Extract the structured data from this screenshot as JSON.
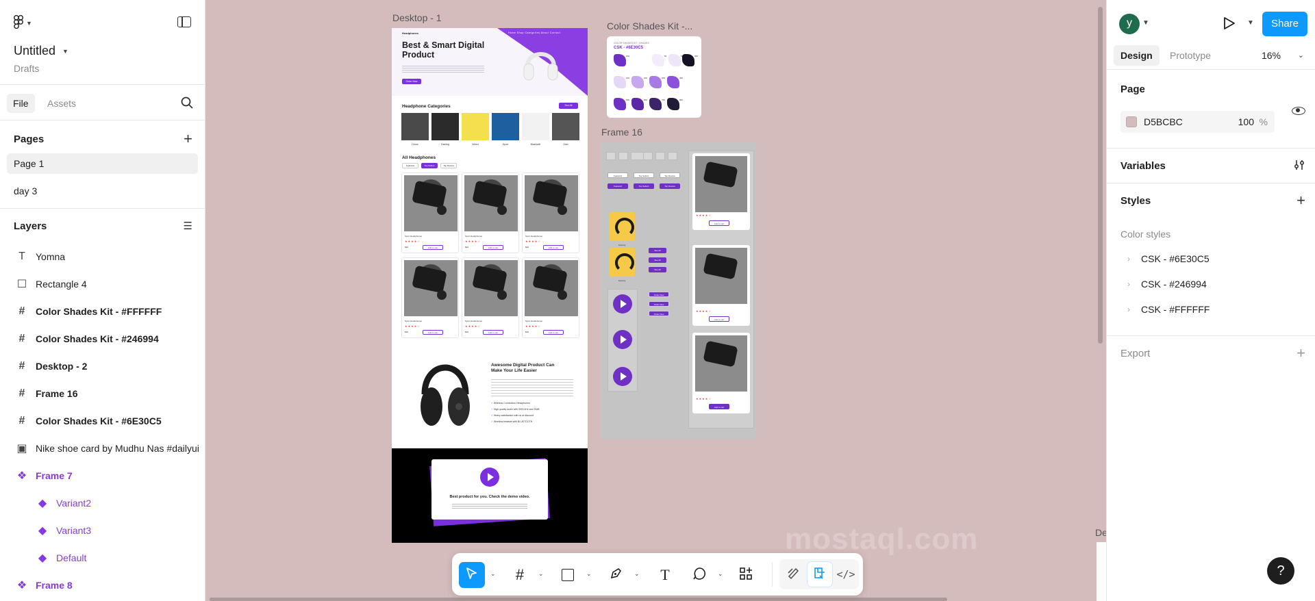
{
  "file": {
    "title": "Untitled",
    "location": "Drafts"
  },
  "left_tabs": {
    "file": "File",
    "assets": "Assets"
  },
  "pages": {
    "heading": "Pages",
    "items": [
      {
        "label": "Page 1",
        "active": true
      },
      {
        "label": "day 3",
        "active": false
      }
    ]
  },
  "layers": {
    "heading": "Layers",
    "items": [
      {
        "label": "Yomna",
        "icon": "text-icon"
      },
      {
        "label": "Rectangle 4",
        "icon": "rectangle-icon"
      },
      {
        "label": "Color Shades Kit - #FFFFFF",
        "icon": "frame-icon"
      },
      {
        "label": "Color Shades Kit - #246994",
        "icon": "frame-icon"
      },
      {
        "label": "Desktop - 2",
        "icon": "frame-icon"
      },
      {
        "label": "Frame 16",
        "icon": "frame-icon"
      },
      {
        "label": "Color Shades Kit - #6E30C5",
        "icon": "frame-icon"
      },
      {
        "label": "Nike shoe card by Mudhu Nas #dailyui",
        "icon": "image-icon"
      },
      {
        "label": "Frame 7",
        "icon": "component-set-icon"
      },
      {
        "label": "Variant2",
        "icon": "component-icon"
      },
      {
        "label": "Variant3",
        "icon": "component-icon"
      },
      {
        "label": "Default",
        "icon": "component-icon"
      },
      {
        "label": "Frame 8",
        "icon": "component-set-icon"
      }
    ]
  },
  "user": {
    "initial": "y",
    "avatar_color": "#1e6b4e"
  },
  "header": {
    "share_label": "Share",
    "share_color": "#0d99ff"
  },
  "right_tabs": {
    "design": "Design",
    "prototype": "Prototype",
    "zoom": "16%"
  },
  "page_section": {
    "title": "Page",
    "background_hex": "D5BCBC",
    "background_color": "#d5bcbc",
    "opacity": "100",
    "opacity_unit": "%"
  },
  "variables": {
    "title": "Variables"
  },
  "styles": {
    "title": "Styles",
    "subheading": "Color styles",
    "items": [
      "CSK - #6E30C5",
      "CSK - #246994",
      "CSK - #FFFFFF"
    ]
  },
  "export": {
    "title": "Export"
  },
  "help": {
    "label": "?"
  },
  "canvas": {
    "desktop_label": "Desktop - 1",
    "kit_label": "Color Shades Kit -...",
    "frame16_label": "Frame 16",
    "edge_label": "De",
    "watermark": "mostaql.com"
  },
  "desktop": {
    "logo": "Headphones",
    "nav": "Home   Shop   Categories   About   Contact",
    "hero_title": "Best & Smart Digital Product",
    "hero_cta": "Order Now",
    "categories_title": "Headphone Categories",
    "see_all": "See All",
    "categories": [
      "Cirrus",
      "Gaming",
      "Wired",
      "Sport",
      "Bluetooth",
      "Over"
    ],
    "all_title": "All Headphones",
    "filters": [
      "Featured",
      "Top Sellers",
      "Top Review"
    ],
    "card_name": "Sport Headphones",
    "card_stars": "★★★★☆",
    "card_price": "$40",
    "card_button": "Add to cart",
    "promo_title": "Awesome Digital Product Can Make Your Life Easier",
    "promo_checks": [
      "Wireless Connection Headphones",
      "High quality audio with 3000 kHz and 20dB",
      "Heavy satisfaction with us at discount",
      "Wireless headset with BLUETOOTH"
    ],
    "video_title": "Best product for you. Check the demo video.",
    "accent_color": "#7b2fe0"
  },
  "kit": {
    "subheading": "COLOR SHADES KIT · SHADES",
    "title": "CSK - #6E30C5",
    "shades": [
      {
        "label": "50",
        "color": "#f3ecfb"
      },
      {
        "label": "100",
        "color": "#6e30c5"
      },
      {
        "label": "50",
        "color": "#ede6f8"
      },
      {
        "label": "900",
        "color": "#141224"
      },
      {
        "label": "100",
        "color": "#e5d8f6"
      },
      {
        "label": "200",
        "color": "#c7a8ee"
      },
      {
        "label": "300",
        "color": "#a87ae5"
      },
      {
        "label": "400",
        "color": "#8b50dc"
      },
      {
        "label": "500",
        "color": "#6e30c5"
      },
      {
        "label": "600",
        "color": "#5b27a8"
      },
      {
        "label": "700",
        "color": "#3b2468"
      },
      {
        "label": "800",
        "color": "#201b36"
      }
    ]
  },
  "frame16": {
    "filters": [
      "Featured",
      "Top Sellers",
      "Top Review"
    ],
    "purple_buttons": [
      "See All",
      "See All",
      "See All"
    ],
    "order_buttons": [
      "Order Now",
      "Order Now",
      "Order Now"
    ],
    "tile_labels": [
      "Gaming",
      "Gaming"
    ],
    "card_button": "Add to cart"
  }
}
